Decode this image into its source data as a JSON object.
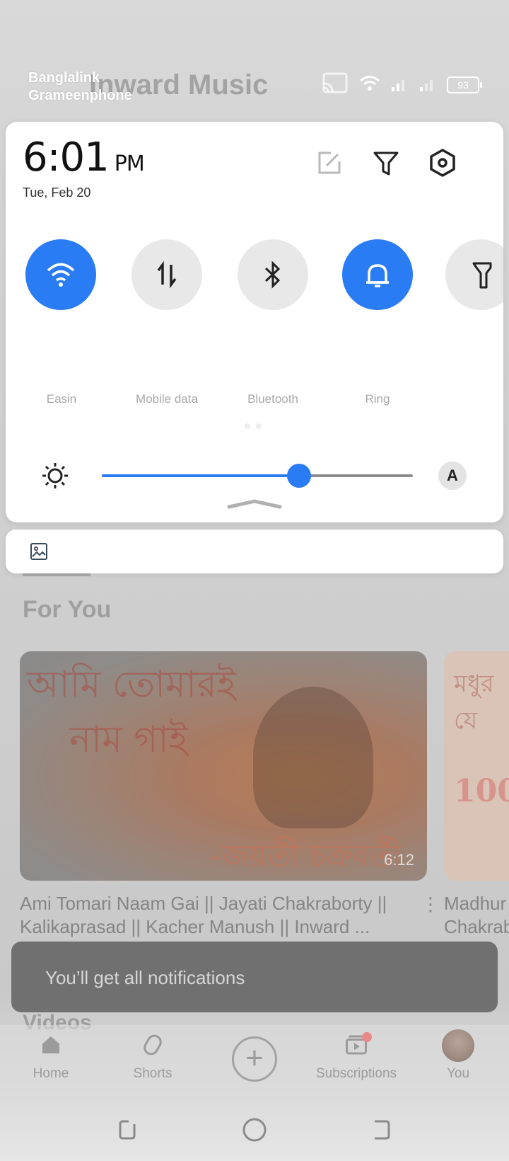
{
  "status_bar": {
    "carrier_1": "Banglalink",
    "carrier_2": "Grameenphone",
    "battery": "93",
    "icons": [
      "cast-icon",
      "wifi-icon",
      "signal-icon",
      "signal-icon",
      "battery-icon"
    ]
  },
  "quick_settings": {
    "time": "6:01",
    "ampm": "PM",
    "date": "Tue, Feb 20",
    "top_icons": [
      "edit-icon",
      "filter-icon",
      "settings-icon"
    ],
    "tiles": [
      {
        "label": "Easin",
        "icon": "wifi-icon",
        "state": "on"
      },
      {
        "label": "Mobile data",
        "icon": "mobile-data-icon",
        "state": "off"
      },
      {
        "label": "Bluetooth",
        "icon": "bluetooth-icon",
        "state": "off"
      },
      {
        "label": "Ring",
        "icon": "bell-icon",
        "state": "on"
      },
      {
        "label": "",
        "icon": "flashlight-icon",
        "state": "off"
      }
    ],
    "brightness_level": 0.635,
    "auto_brightness_label": "A",
    "accent_color": "#2a7cf5"
  },
  "background_app": {
    "channel_title": "Inward Music",
    "section_title": "For You",
    "video_1": {
      "title": "Ami Tomari Naam Gai || Jayati Chakraborty || Kalikaprasad || Kacher Manush || Inward ...",
      "duration": "6:12",
      "thumb_line_1": "আমি তোমারই",
      "thumb_line_2": "নাম গাই",
      "thumb_line_3": "-জয়তী চক্রবর্তী"
    },
    "video_2": {
      "title_line_1": "Madhur",
      "title_line_2": "Chakrab",
      "thumb_line_1": "মধুর",
      "thumb_line_2": "যে",
      "thumb_line_3": "100"
    },
    "next_section": "Videos",
    "nav": {
      "home": "Home",
      "shorts": "Shorts",
      "subscriptions": "Subscriptions",
      "you": "You"
    }
  },
  "toast": {
    "text": "You’ll get all notifications"
  }
}
